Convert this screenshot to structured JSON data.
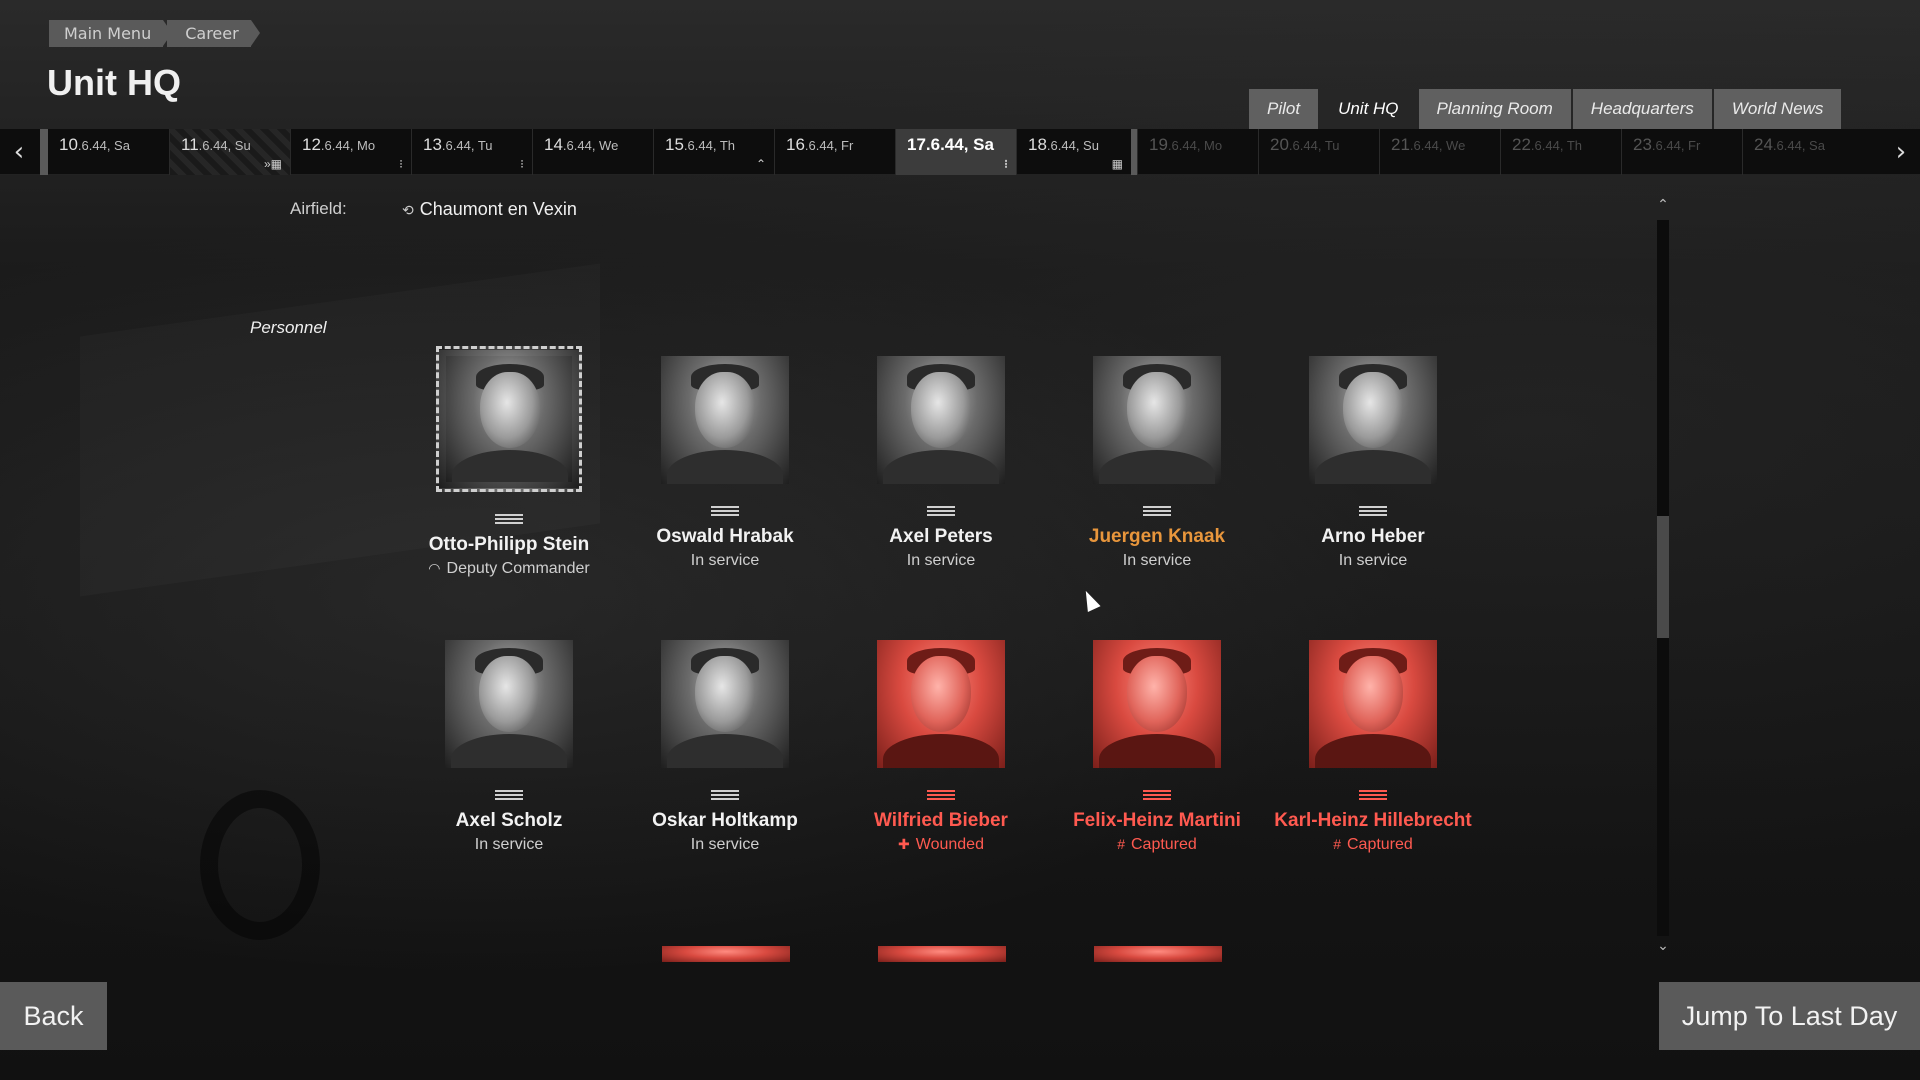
{
  "breadcrumb": [
    "Main Menu",
    "Career"
  ],
  "page_title": "Unit HQ",
  "tabs": [
    {
      "label": "Pilot",
      "active": false
    },
    {
      "label": "Unit HQ",
      "active": true
    },
    {
      "label": "Planning Room",
      "active": false
    },
    {
      "label": "Headquarters",
      "active": false
    },
    {
      "label": "World News",
      "active": false
    }
  ],
  "timeline": {
    "days": [
      {
        "big": "10",
        "rest": ".6.44, Sa",
        "state": "past",
        "indicator": ""
      },
      {
        "big": "11",
        "rest": ".6.44, Su",
        "state": "hatched",
        "indicator": "»▦"
      },
      {
        "big": "12",
        "rest": ".6.44, Mo",
        "state": "past",
        "indicator": "⁝"
      },
      {
        "big": "13",
        "rest": ".6.44, Tu",
        "state": "past",
        "indicator": "⁝"
      },
      {
        "big": "14",
        "rest": ".6.44, We",
        "state": "past",
        "indicator": ""
      },
      {
        "big": "15",
        "rest": ".6.44, Th",
        "state": "past",
        "indicator": "⌃"
      },
      {
        "big": "16",
        "rest": ".6.44, Fr",
        "state": "past",
        "indicator": ""
      },
      {
        "big": "17.6.44, Sa",
        "rest": "",
        "state": "active",
        "indicator": "⁝"
      },
      {
        "big": "18",
        "rest": ".6.44, Su",
        "state": "cut",
        "indicator": "▦"
      },
      {
        "big": "19",
        "rest": ".6.44, Mo",
        "state": "future",
        "indicator": ""
      },
      {
        "big": "20",
        "rest": ".6.44, Tu",
        "state": "future",
        "indicator": ""
      },
      {
        "big": "21",
        "rest": ".6.44, We",
        "state": "future",
        "indicator": ""
      },
      {
        "big": "22",
        "rest": ".6.44, Th",
        "state": "future",
        "indicator": ""
      },
      {
        "big": "23",
        "rest": ".6.44, Fr",
        "state": "future",
        "indicator": ""
      },
      {
        "big": "24",
        "rest": ".6.44, Sa",
        "state": "future",
        "indicator": ""
      }
    ]
  },
  "airfield": {
    "label": "Airfield:",
    "value": "Chaumont en Vexin"
  },
  "section_title": "Personnel",
  "personnel": [
    {
      "name": "Otto-Philipp Stein",
      "status": "Deputy Commander",
      "status_icon": "cap",
      "color": "normal",
      "framed": true
    },
    {
      "name": "Oswald Hrabak",
      "status": "In service",
      "status_icon": "",
      "color": "normal",
      "framed": false
    },
    {
      "name": "Axel Peters",
      "status": "In service",
      "status_icon": "",
      "color": "normal",
      "framed": false
    },
    {
      "name": "Juergen Knaak",
      "status": "In service",
      "status_icon": "",
      "color": "orange",
      "framed": false
    },
    {
      "name": "Arno Heber",
      "status": "In service",
      "status_icon": "",
      "color": "normal",
      "framed": false
    },
    {
      "name": "Axel Scholz",
      "status": "In service",
      "status_icon": "",
      "color": "normal",
      "framed": false
    },
    {
      "name": "Oskar Holtkamp",
      "status": "In service",
      "status_icon": "",
      "color": "normal",
      "framed": false
    },
    {
      "name": "Wilfried Bieber",
      "status": "Wounded",
      "status_icon": "cross",
      "color": "red",
      "framed": false
    },
    {
      "name": "Felix-Heinz Martini",
      "status": "Captured",
      "status_icon": "grid",
      "color": "red",
      "framed": false
    },
    {
      "name": "Karl-Heinz Hillebrecht",
      "status": "Captured",
      "status_icon": "grid",
      "color": "red",
      "framed": false
    }
  ],
  "buttons": {
    "back": "Back",
    "jump": "Jump To Last Day"
  },
  "colors": {
    "accent_orange": "#e8963c",
    "alert_red": "#ff5a50",
    "button_gray": "#5a5a5a"
  }
}
